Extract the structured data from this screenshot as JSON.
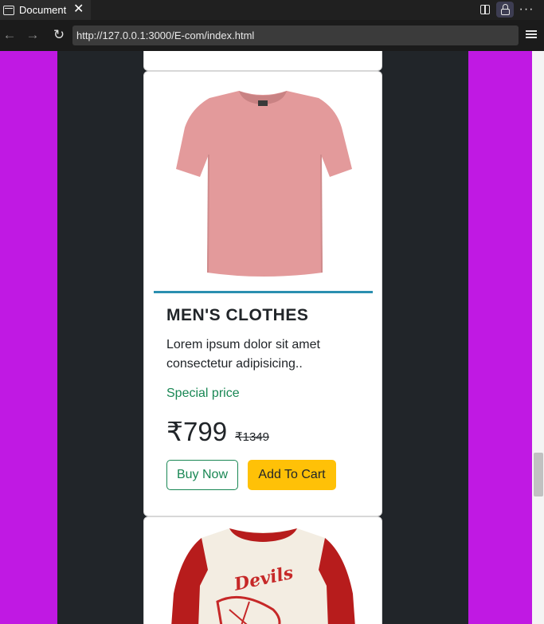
{
  "browser": {
    "tab_title": "Document",
    "url": "http://127.0.0.1:3000/E-com/index.html"
  },
  "product": {
    "title": "MEN'S CLOTHES",
    "description": "Lorem ipsum dolor sit amet consectetur adipisicing..",
    "special_label": "Special price",
    "price": "₹799",
    "old_price": "₹1349",
    "buy_label": "Buy Now",
    "cart_label": "Add To Cart"
  },
  "next_product": {
    "shirt_print": "Devils"
  },
  "colors": {
    "page_bg": "#c019e3",
    "container_bg": "#212529",
    "divider": "#2b8fb0",
    "special": "#198754",
    "cart_button": "#ffc107",
    "shirt": "#e39a9b"
  }
}
